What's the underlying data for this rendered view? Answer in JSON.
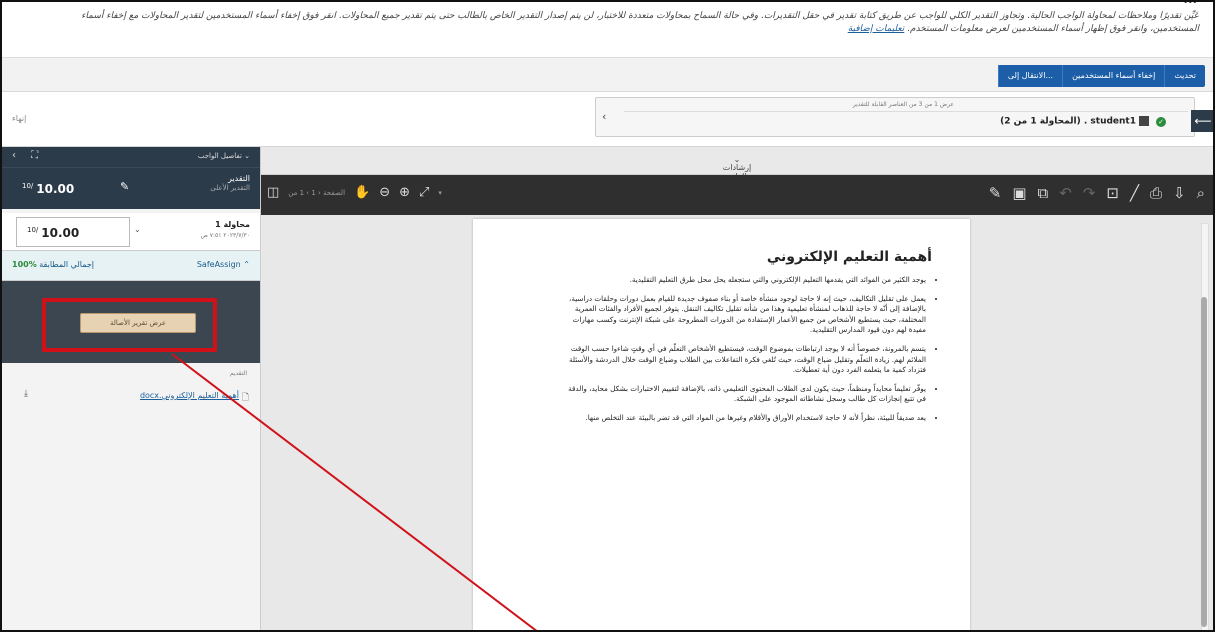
{
  "instructions": {
    "title": "...",
    "line1": "عَيِّن تقديرًا وملاحظات لمحاولة الواجب الحالية. وتجاوز التقدير الكلي للواجب عن طريق كتابة تقدير في حقل التقديرات. وفي حالة السماح بمحاولات متعددة للاختبار، لن يتم إصدار التقدير الخاص بالطالب حتى يتم تقدير جميع المحاولات. انقر فوق إخفاء أسماء المستخدمين لتقدير المحاولات مع إخفاء أسماء",
    "line2": "المستخدمين، وانقر فوق إظهار أسماء المستخدمين لعرض معلومات المستخدم.",
    "link": "تعليمات إضافية"
  },
  "nav": {
    "update": "تحديث",
    "hide_names": "إخفاء أسماء المستخدمين",
    "goto": "الانتقال إلى..."
  },
  "header": {
    "finish": "إنهاء",
    "counter": "عرض 1 من 3 من العناصر القابلة للتقدير",
    "student": "student1 . (المحاولة 1 من 2)"
  },
  "left_panel": {
    "details_label": "تفاصيل الواجب",
    "grade_label": "التقدير",
    "grade_sub": "التقدير الأعلى",
    "grade_value": "10.00",
    "grade_max": "10/",
    "attempt_label": "محاولة 1",
    "attempt_date": "٢٠٢٣/٧/٣٠ ٧:٥١ ص",
    "attempt_value": "10.00",
    "attempt_max": "10/",
    "safeassign_label": "SafeAssign",
    "safeassign_value": "100%",
    "safeassign_text": "إجمالي المطابقة",
    "report_button": "عرض تقرير الأصالة",
    "files_label": "التقديم",
    "file_name": "أهمية التعليم الإلكتروني.docx"
  },
  "viewer": {
    "header": "إرشادات الواجب",
    "page_label": "الصفحة",
    "page_current": "1",
    "page_total": "1 من"
  },
  "document": {
    "title": "أهمية التعليم الإلكتروني",
    "bullets": [
      "يوجد الكثير من الفوائد التي يقدمها التعليم الإلكتروني والتي ستجعله يحل محل طرق التعليم التقليدية.",
      "يعمل على تقليل التكاليف، حيث إنه لا حاجة لوجود منشأة خاصة أو بناء صفوف جديدة للقيام بعمل دورات وحلقات دراسية، بالإضافة إلى أنّه لا حاجة للذهاب لمنشأة تعليمية وهذا من شأنه تقليل تكاليف التنقل. يتوفر لجميع الأفراد والفئات العمرية المختلفة، حيث يستطيع الأشخاص من جميع الأعمار الإستفادة من الدورات المطروحة على شبكة الإنترنت وكسب مهارات مفيدة لهم دون قيود المدارس التقليدية.",
      "يتسم بالمرونة، خصوصاً أنه لا يوجد ارتباطات بموضوع الوقت، فيستطيع الأشخاص التعلّم في أي وقتٍ شاءوا حسب الوقت الملائم لهم. زيادة التعلّم وتقليل ضياع الوقت، حيث تُلغي فكرة التفاعلات بين الطلاب وضياع الوقت خلال الدردشة والأسئلة فتزداد كمية ما يتعلمه الفرد دون أية تعطيلات.",
      "يوفّر تعليماً محايداً ومنظماً، حيث يكون لدى الطلاب المحتوى التعليمي ذاته، بالإضافة لتقييم الاختبارات بشكل محايد، والدقة في تتبع إنجازات كل طالب وسجل نشاطاته الموجود على الشبكة.",
      "يعد صديقاً للبيئة، نظراً لأنه لا حاجة لاستخدام الأوراق والأقلام وغيرها من المواد التي قد تضر بالبيئة عند التخلص منها."
    ]
  },
  "colors": {
    "nav_blue": "#1d5ea8",
    "dark_panel": "#2b3b4a",
    "annotation_red": "#d0111a"
  }
}
